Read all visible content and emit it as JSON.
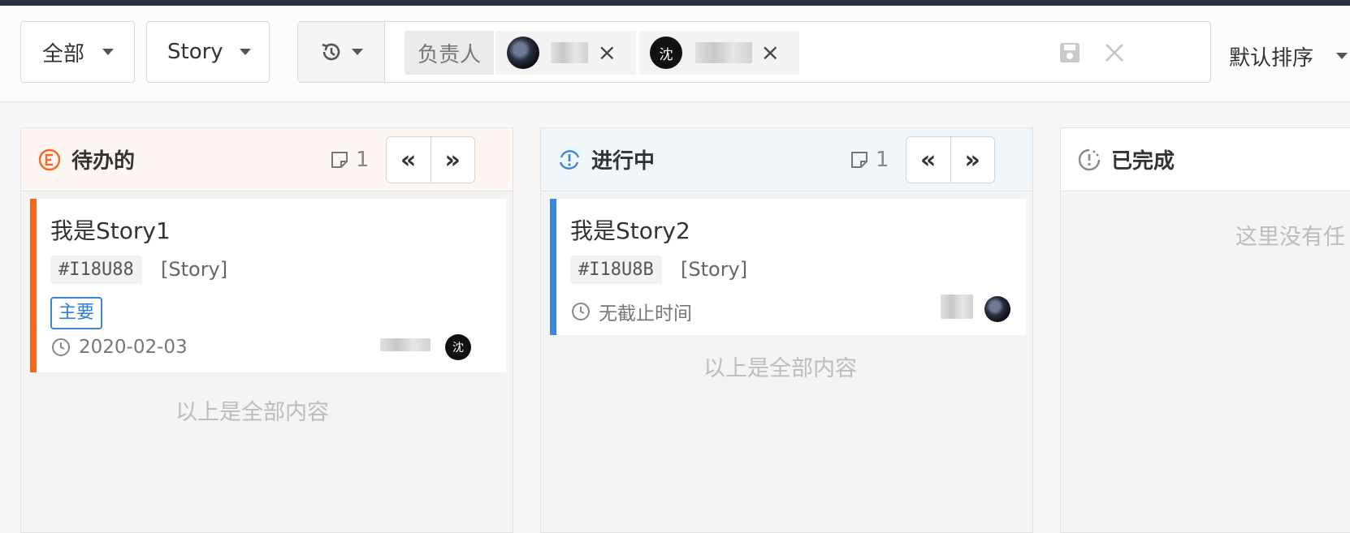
{
  "toolbar": {
    "scope_label": "全部",
    "type_label": "Story",
    "history_icon": "history-icon",
    "filter": {
      "field_label": "负责人",
      "chips": [
        {
          "avatar_text": "",
          "name": "",
          "remove": "×"
        },
        {
          "avatar_text": "沈",
          "name": "",
          "remove": "×"
        }
      ]
    },
    "sort_label": "默认排序"
  },
  "columns": [
    {
      "title": "待办的",
      "count": "1",
      "accent": "#f26b1d",
      "end_text": "以上是全部内容",
      "cards": [
        {
          "title": "我是Story1",
          "code": "#I18U88",
          "type": "[Story]",
          "tag": "主要",
          "due": "2020-02-03",
          "avatar_text": "沈"
        }
      ]
    },
    {
      "title": "进行中",
      "count": "1",
      "accent": "#3a86d8",
      "end_text": "以上是全部内容",
      "cards": [
        {
          "title": "我是Story2",
          "code": "#I18U8B",
          "type": "[Story]",
          "due": "无截止时间"
        }
      ]
    },
    {
      "title": "已完成",
      "accent": "#888888",
      "empty_text": "这里没有任"
    }
  ]
}
